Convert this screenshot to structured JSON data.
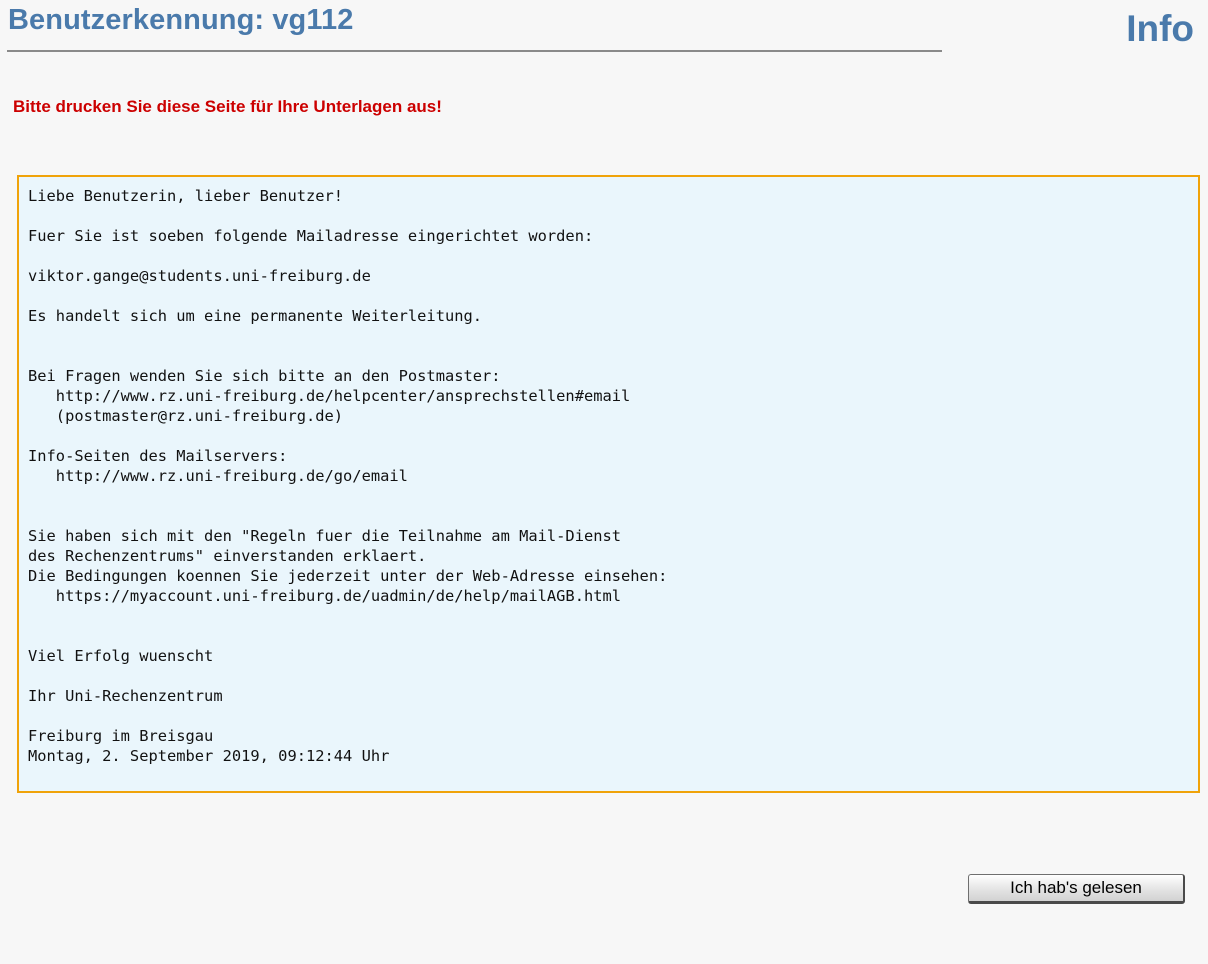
{
  "header": {
    "title": "Benutzerkennung: vg112",
    "info_label": "Info"
  },
  "warning": "Bitte drucken Sie diese Seite für Ihre Unterlagen aus!",
  "message": {
    "lines": [
      "Liebe Benutzerin, lieber Benutzer!",
      "",
      "Fuer Sie ist soeben folgende Mailadresse eingerichtet worden:",
      "",
      "viktor.gange@students.uni-freiburg.de",
      "",
      "Es handelt sich um eine permanente Weiterleitung.",
      "",
      "",
      "Bei Fragen wenden Sie sich bitte an den Postmaster:",
      "   http://www.rz.uni-freiburg.de/helpcenter/ansprechstellen#email",
      "   (postmaster@rz.uni-freiburg.de)",
      "",
      "Info-Seiten des Mailservers:",
      "   http://www.rz.uni-freiburg.de/go/email",
      "",
      "",
      "Sie haben sich mit den \"Regeln fuer die Teilnahme am Mail-Dienst",
      "des Rechenzentrums\" einverstanden erklaert.",
      "Die Bedingungen koennen Sie jederzeit unter der Web-Adresse einsehen:",
      "   https://myaccount.uni-freiburg.de/uadmin/de/help/mailAGB.html",
      "",
      "",
      "Viel Erfolg wuenscht",
      "",
      "Ihr Uni-Rechenzentrum",
      "",
      "Freiburg im Breisgau",
      "Montag, 2. September 2019, 09:12:44 Uhr"
    ]
  },
  "actions": {
    "confirm_label": "Ich hab's gelesen"
  },
  "colors": {
    "heading": "#4a7aab",
    "warning": "#cc0000",
    "box_border": "#f0a30a",
    "box_background": "#eaf6fc"
  }
}
